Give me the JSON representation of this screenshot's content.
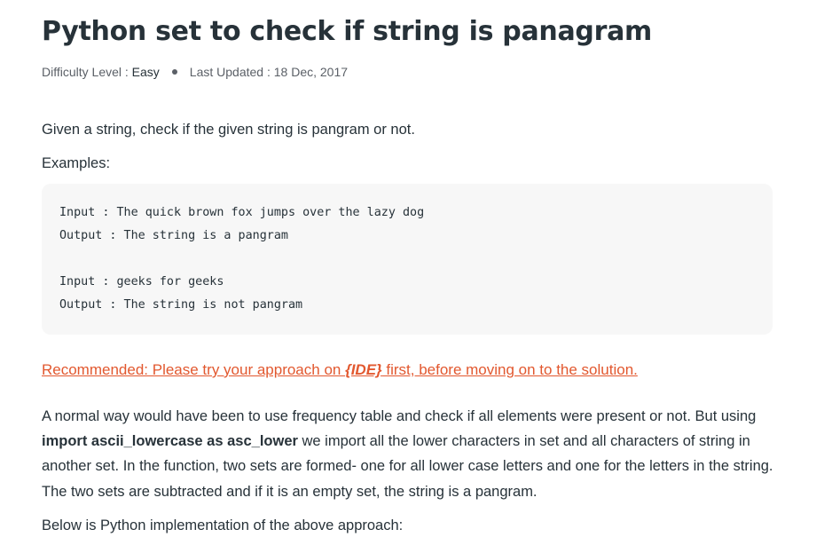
{
  "article": {
    "title": "Python set to check if string is panagram",
    "meta": {
      "difficulty_label": "Difficulty Level : ",
      "difficulty_value": "Easy",
      "updated_label": "Last Updated : ",
      "updated_value": "18 Dec, 2017"
    },
    "intro": "Given a string, check if the given string is pangram or not.",
    "examples_label": "Examples:",
    "code_lines": [
      "Input : The quick brown fox jumps over the lazy dog",
      "Output : The string is a pangram",
      "",
      "Input : geeks for geeks",
      "Output : The string is not pangram"
    ],
    "recommended": {
      "prefix": "Recommended: Please try your approach on ",
      "ide": "{IDE}",
      "suffix": " first, before moving on to the solution."
    },
    "body": {
      "part1": "A normal way would have been to use frequency table and check if all elements were present or not. But using ",
      "bold": "import ascii_lowercase as asc_lower",
      "part2": " we import all the lower characters in set and all characters of string in another set. In the function, two sets are formed- one for all lower case letters and one for the letters in the string. The two sets are subtracted and if it is an empty set, the string is a pangram."
    },
    "below": "Below is Python implementation of the above approach:"
  }
}
